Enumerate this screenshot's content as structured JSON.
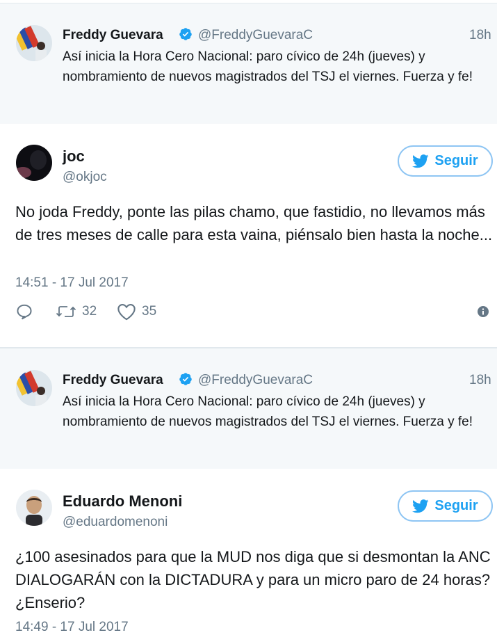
{
  "quote1": {
    "name": "Freddy Guevara",
    "handle": "@FreddyGuevaraC",
    "time": "18h",
    "text": "Así inicia la Hora Cero Nacional: paro cívico de 24h (jueves) y nombramiento de nuevos magistrados del TSJ el viernes. Fuerza y fe!"
  },
  "tweet1": {
    "name": "joc",
    "handle": "@okjoc",
    "follow_label": "Seguir",
    "text": "No joda Freddy, ponte las pilas chamo, que fastidio, no llevamos más de tres meses de calle para esta vaina, piénsalo bien hasta la noche...",
    "datetime": "14:51 - 17 Jul 2017",
    "retweets": "32",
    "likes": "35"
  },
  "quote2": {
    "name": "Freddy Guevara",
    "handle": "@FreddyGuevaraC",
    "time": "18h",
    "text": "Así inicia la Hora Cero Nacional: paro cívico de 24h (jueves) y nombramiento de nuevos magistrados del TSJ el viernes. Fuerza y fe!"
  },
  "tweet2": {
    "name": "Eduardo Menoni",
    "handle": "@eduardomenoni",
    "follow_label": "Seguir",
    "text": "¿100 asesinados para que la MUD nos diga que si desmontan la ANC DIALOGARÁN con la DICTADURA y para un micro paro de 24 horas? ¿Enserio?",
    "datetime": "14:49 - 17 Jul 2017"
  },
  "colors": {
    "link_blue": "#1da1f2",
    "quoted_bg": "#f5f8fa",
    "secondary_text": "#657786"
  }
}
